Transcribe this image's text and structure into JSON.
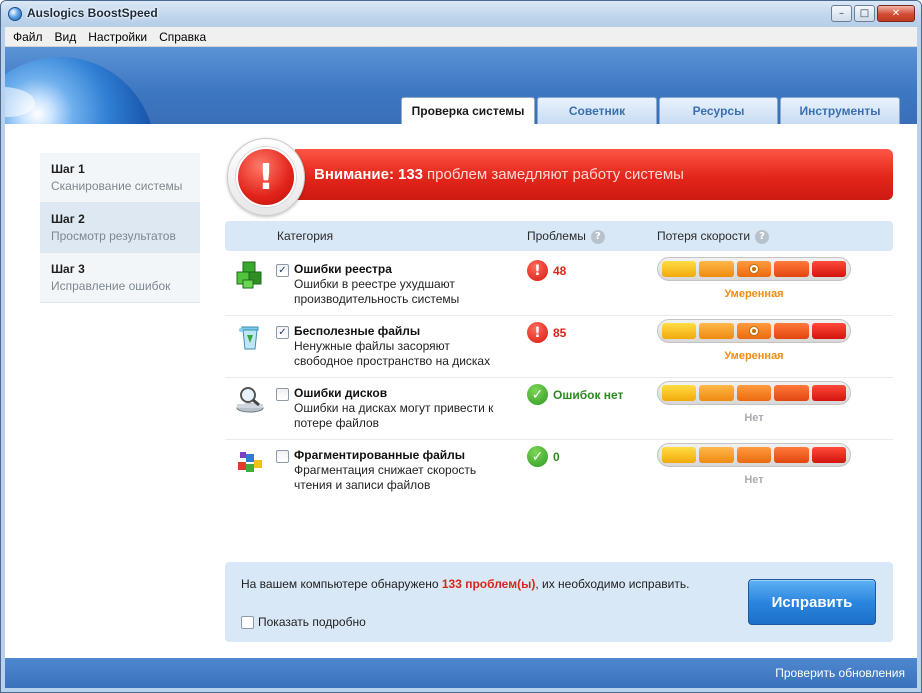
{
  "window": {
    "title": "Auslogics BoostSpeed"
  },
  "menu": [
    "Файл",
    "Вид",
    "Настройки",
    "Справка"
  ],
  "tabs": [
    {
      "label": "Проверка системы",
      "active": true
    },
    {
      "label": "Советник",
      "active": false
    },
    {
      "label": "Ресурсы",
      "active": false
    },
    {
      "label": "Инструменты",
      "active": false
    }
  ],
  "steps": [
    {
      "title": "Шаг 1",
      "subtitle": "Сканирование системы",
      "active": false
    },
    {
      "title": "Шаг 2",
      "subtitle": "Просмотр результатов",
      "active": true
    },
    {
      "title": "Шаг 3",
      "subtitle": "Исправление ошибок",
      "active": false
    }
  ],
  "alert": {
    "prefix": "Внимание:",
    "count": "133",
    "message": "проблем замедляют работу системы"
  },
  "table": {
    "headers": {
      "category": "Категория",
      "problems": "Проблемы",
      "speed": "Потеря скорости"
    },
    "rows": [
      {
        "title": "Ошибки реестра",
        "desc": "Ошибки в реестре ухудшают производительность системы",
        "checked": true,
        "status": "48",
        "status_type": "bad",
        "level_index": 2,
        "level_label": "Умеренная",
        "level_type": "mid",
        "icon": "registry-cubes-icon"
      },
      {
        "title": "Бесполезные файлы",
        "desc": "Ненужные файлы засоряют свободное пространство на дисках",
        "checked": true,
        "status": "85",
        "status_type": "bad",
        "level_index": 2,
        "level_label": "Умеренная",
        "level_type": "mid",
        "icon": "recycle-bin-icon"
      },
      {
        "title": "Ошибки дисков",
        "desc": "Ошибки на дисках могут привести к потере файлов",
        "checked": false,
        "status": "Ошибок нет",
        "status_type": "ok",
        "level_index": null,
        "level_label": "Нет",
        "level_type": "none",
        "icon": "disk-magnifier-icon"
      },
      {
        "title": "Фрагментированные файлы",
        "desc": "Фрагментация снижает скорость чтения и записи файлов",
        "checked": false,
        "status": "0",
        "status_type": "ok",
        "level_index": null,
        "level_label": "Нет",
        "level_type": "none",
        "icon": "fragmented-blocks-icon"
      }
    ]
  },
  "summary": {
    "before": "На вашем компьютере обнаружено ",
    "highlight": "133 проблем(ы)",
    "after": ", их необходимо исправить."
  },
  "details_label": "Показать подробно",
  "fix_button": "Исправить",
  "update_link": "Проверить обновления",
  "colors": {
    "alert": "#e3261b",
    "accent": "#3a72bb",
    "moderate": "#ef8c12"
  }
}
